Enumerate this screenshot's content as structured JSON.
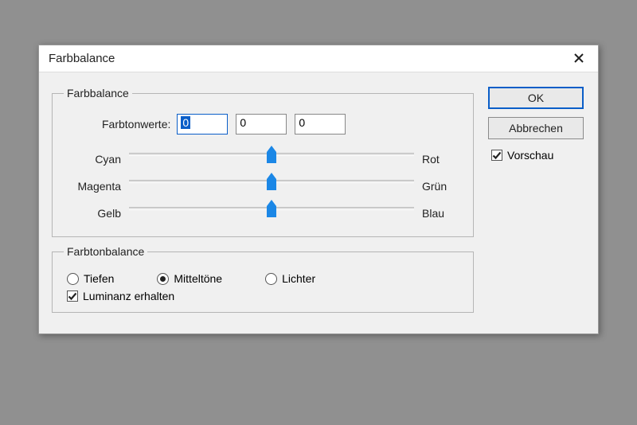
{
  "dialog": {
    "title": "Farbbalance"
  },
  "farbbalance": {
    "legend": "Farbbalance",
    "tonwerte_label": "Farbtonwerte:",
    "value1": "0",
    "value2": "0",
    "value3": "0",
    "sliders": {
      "s1_left": "Cyan",
      "s1_right": "Rot",
      "s2_left": "Magenta",
      "s2_right": "Grün",
      "s3_left": "Gelb",
      "s3_right": "Blau"
    }
  },
  "tonebalance": {
    "legend": "Farbtonbalance",
    "tiefen": "Tiefen",
    "mitteltoene": "Mitteltöne",
    "lichter": "Lichter",
    "luminanz": "Luminanz erhalten"
  },
  "buttons": {
    "ok": "OK",
    "cancel": "Abbrechen",
    "preview": "Vorschau"
  }
}
